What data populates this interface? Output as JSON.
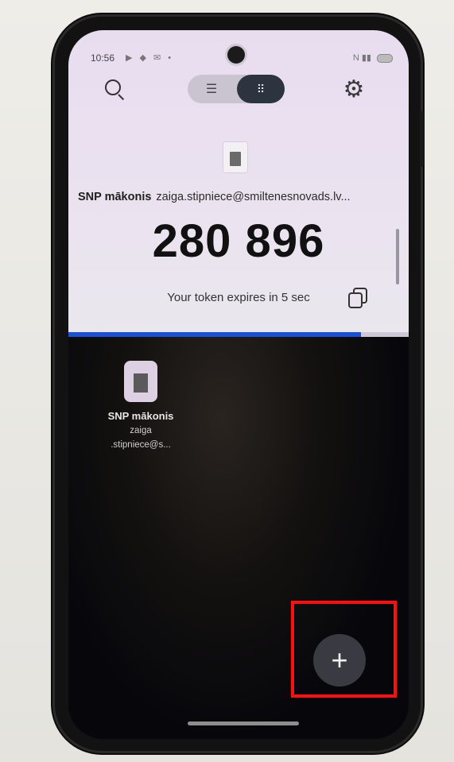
{
  "status_bar": {
    "time": "10:56",
    "left_icons": [
      "notification-icon",
      "notification-icon",
      "mail-icon",
      "dot"
    ],
    "right_icons": [
      "nfc-icon",
      "signal-icon",
      "battery-icon"
    ]
  },
  "toolbar": {
    "search_icon": "search-icon",
    "view_list_icon": "list-view-icon",
    "view_grid_icon": "grid-view-icon",
    "selected_view": "grid",
    "settings_icon": "gear-icon"
  },
  "active_account": {
    "name": "SNP mākonis",
    "email": "zaiga.stipniece@smiltenesnovads.lv...",
    "token": "280 896",
    "expires_text": "Your token expires in 5 sec",
    "copy_icon": "copy-icon",
    "progress": 0.86
  },
  "accounts": [
    {
      "name": "SNP mākonis",
      "line1": "zaiga",
      "line2": ".stipniece@s..."
    }
  ],
  "fab": {
    "label": "+",
    "icon": "add-icon"
  },
  "colors": {
    "progress": "#1f4fd6",
    "highlight": "#ff1010",
    "fab": "#3a3b42"
  }
}
